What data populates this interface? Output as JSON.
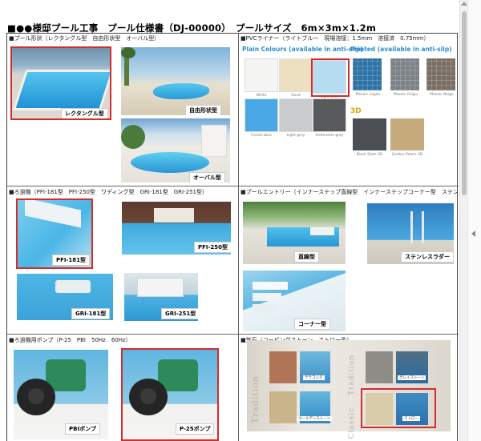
{
  "document": {
    "title": "■●●様邸プール工事　プール仕様書（DJ-00000）　プールサイズ　6m×3m×1.2m"
  },
  "sections": {
    "pool_shape": {
      "label": "■プール形状（レクタングル型　自由形状型　オーバル型）",
      "items": [
        "レクタングル型",
        "自由形状型",
        "オーバル型"
      ]
    },
    "pvc_liner": {
      "label": "■PVCライナー（ライトブルー　現場溶接：1.5mm　溶接済　0.75mm）",
      "plain_header": "Plain Colours (available in anti-slip)",
      "printed_header": "Printed (available in anti-slip)",
      "header_3d": "3D",
      "plain": [
        {
          "name": "White",
          "color": "#f4f4f2"
        },
        {
          "name": "Sand",
          "color": "#ede0c0"
        },
        {
          "name": "Light blue",
          "color": "#b5dcf0"
        },
        {
          "name": "French blue",
          "color": "#4aa8e6"
        },
        {
          "name": "Light grey",
          "color": "#c9cbcd"
        },
        {
          "name": "Anthracite grey",
          "color": "#58595b"
        }
      ],
      "printed": [
        {
          "name": "Mosaic Lagon",
          "color": "#2f73a6"
        },
        {
          "name": "Mosaic Grigio",
          "color": "#7d8287"
        },
        {
          "name": "Mosaic Beige",
          "color": "#7a6e65"
        }
      ],
      "printed_3d": [
        {
          "name": "Black Slate 3D",
          "color": "#4b4e52"
        },
        {
          "name": "Golden Pearls 3D",
          "color": "#c8ab7c"
        }
      ]
    },
    "filter": {
      "label": "■ろ過機（PFI-181型　PFI-250型　ワディング型　GRI-181型　GRI-251型）",
      "items": [
        "PFI-181型",
        "PFI-250型",
        "GRI-181型",
        "GRI-251型"
      ]
    },
    "entry": {
      "label": "■プールエントリー（インナーステップ直線型　インナーステップコーナー型　ステンレスラダー）",
      "items": [
        "直線型",
        "ステンレスラダー",
        "コーナー型"
      ]
    },
    "pump": {
      "label": "■ろ過機用ポンプ（P-25　PBI　50Hz　60Hz）",
      "items": [
        "PBIポンプ",
        "P-25ポンプ"
      ]
    },
    "coping": {
      "label": "■笠石（コーピングストーン　ストロー色）",
      "vertical_left": "Tradition",
      "vertical_mid": "Tradition",
      "vertical_low": "Classic",
      "items": [
        {
          "name": "テラコッタ",
          "color": "#b07556"
        },
        {
          "name": "ゴールデンストーン",
          "color": "#c9b48c"
        },
        {
          "name": "グレイストーン",
          "color": "#8f8d88"
        },
        {
          "name": "ストロー",
          "color": "#d8cba9"
        }
      ]
    }
  }
}
